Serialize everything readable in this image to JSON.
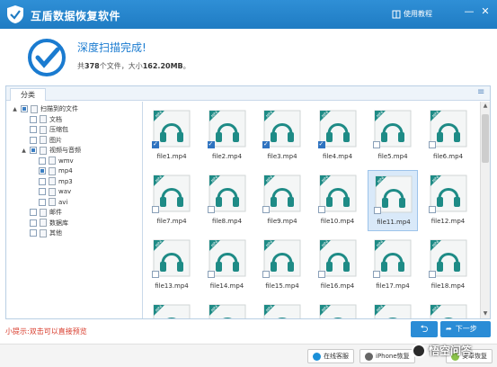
{
  "titlebar": {
    "title": "互盾数据恢复软件",
    "help_label": "使用教程",
    "minimize": "—",
    "close": "✕"
  },
  "header": {
    "status_title": "深度扫描完成!",
    "summary_prefix": "共",
    "file_count": "378",
    "summary_mid": "个文件，大小",
    "total_size": "162.20MB",
    "summary_suffix": "。"
  },
  "panel": {
    "tab_label": "分类",
    "tree": [
      {
        "label": "扫描到的文件",
        "level": 0,
        "expander": "▲",
        "check": "partial",
        "icon": "root"
      },
      {
        "label": "文档",
        "level": 1,
        "expander": "",
        "check": "off",
        "icon": "doc"
      },
      {
        "label": "压缩包",
        "level": 1,
        "expander": "",
        "check": "off",
        "icon": "zip"
      },
      {
        "label": "图片",
        "level": 1,
        "expander": "",
        "check": "off",
        "icon": "img"
      },
      {
        "label": "视频与音频",
        "level": 1,
        "expander": "▲",
        "check": "partial",
        "icon": "media"
      },
      {
        "label": "wmv",
        "level": 2,
        "expander": "",
        "check": "off",
        "icon": "media"
      },
      {
        "label": "mp4",
        "level": 2,
        "expander": "",
        "check": "partial",
        "icon": "media"
      },
      {
        "label": "mp3",
        "level": 2,
        "expander": "",
        "check": "off",
        "icon": "audio"
      },
      {
        "label": "wav",
        "level": 2,
        "expander": "",
        "check": "off",
        "icon": "audio"
      },
      {
        "label": "avi",
        "level": 2,
        "expander": "",
        "check": "off",
        "icon": "media"
      },
      {
        "label": "邮件",
        "level": 1,
        "expander": "",
        "check": "off",
        "icon": "mail"
      },
      {
        "label": "数据库",
        "level": 1,
        "expander": "",
        "check": "off",
        "icon": "db"
      },
      {
        "label": "其他",
        "level": 1,
        "expander": "",
        "check": "off",
        "icon": "other"
      }
    ],
    "files": [
      {
        "name": "file1.mp4",
        "checked": true,
        "selected": false
      },
      {
        "name": "file2.mp4",
        "checked": true,
        "selected": false
      },
      {
        "name": "file3.mp4",
        "checked": true,
        "selected": false
      },
      {
        "name": "file4.mp4",
        "checked": true,
        "selected": false
      },
      {
        "name": "file5.mp4",
        "checked": false,
        "selected": false
      },
      {
        "name": "file6.mp4",
        "checked": false,
        "selected": false
      },
      {
        "name": "file7.mp4",
        "checked": false,
        "selected": false
      },
      {
        "name": "file8.mp4",
        "checked": false,
        "selected": false
      },
      {
        "name": "file9.mp4",
        "checked": false,
        "selected": false
      },
      {
        "name": "file10.mp4",
        "checked": false,
        "selected": false
      },
      {
        "name": "file11.mp4",
        "checked": false,
        "selected": true
      },
      {
        "name": "file12.mp4",
        "checked": false,
        "selected": false
      },
      {
        "name": "file13.mp4",
        "checked": false,
        "selected": false
      },
      {
        "name": "file14.mp4",
        "checked": false,
        "selected": false
      },
      {
        "name": "file15.mp4",
        "checked": false,
        "selected": false
      },
      {
        "name": "file16.mp4",
        "checked": false,
        "selected": false
      },
      {
        "name": "file17.mp4",
        "checked": false,
        "selected": false
      },
      {
        "name": "file18.mp4",
        "checked": false,
        "selected": false
      },
      {
        "name": "",
        "checked": false,
        "selected": false
      },
      {
        "name": "",
        "checked": false,
        "selected": false
      },
      {
        "name": "",
        "checked": false,
        "selected": false
      },
      {
        "name": "",
        "checked": false,
        "selected": false
      },
      {
        "name": "",
        "checked": false,
        "selected": false
      },
      {
        "name": "",
        "checked": false,
        "selected": false
      }
    ],
    "file_badge": "MP4"
  },
  "hint": "小提示:双击可以直接预览",
  "nav": {
    "back_glyph": "⮌",
    "next_label": "下一步",
    "next_glyph": "➦"
  },
  "footer": {
    "buttons": [
      {
        "label": "在线客服",
        "icon": "qq-icon",
        "color": "#1a8fd8"
      },
      {
        "label": "iPhone恢复",
        "icon": "apple-icon",
        "color": "#666666"
      },
      {
        "label": "安卓恢复",
        "icon": "android-icon",
        "color": "#8bc34a"
      }
    ]
  },
  "watermark": "悟空问答",
  "colors": {
    "titlebar": "#2482c9",
    "accent": "#1a7bd0",
    "hint": "#d83a2a",
    "teal_icon": "#1e8b86",
    "primary_button": "#2a8cd6"
  }
}
